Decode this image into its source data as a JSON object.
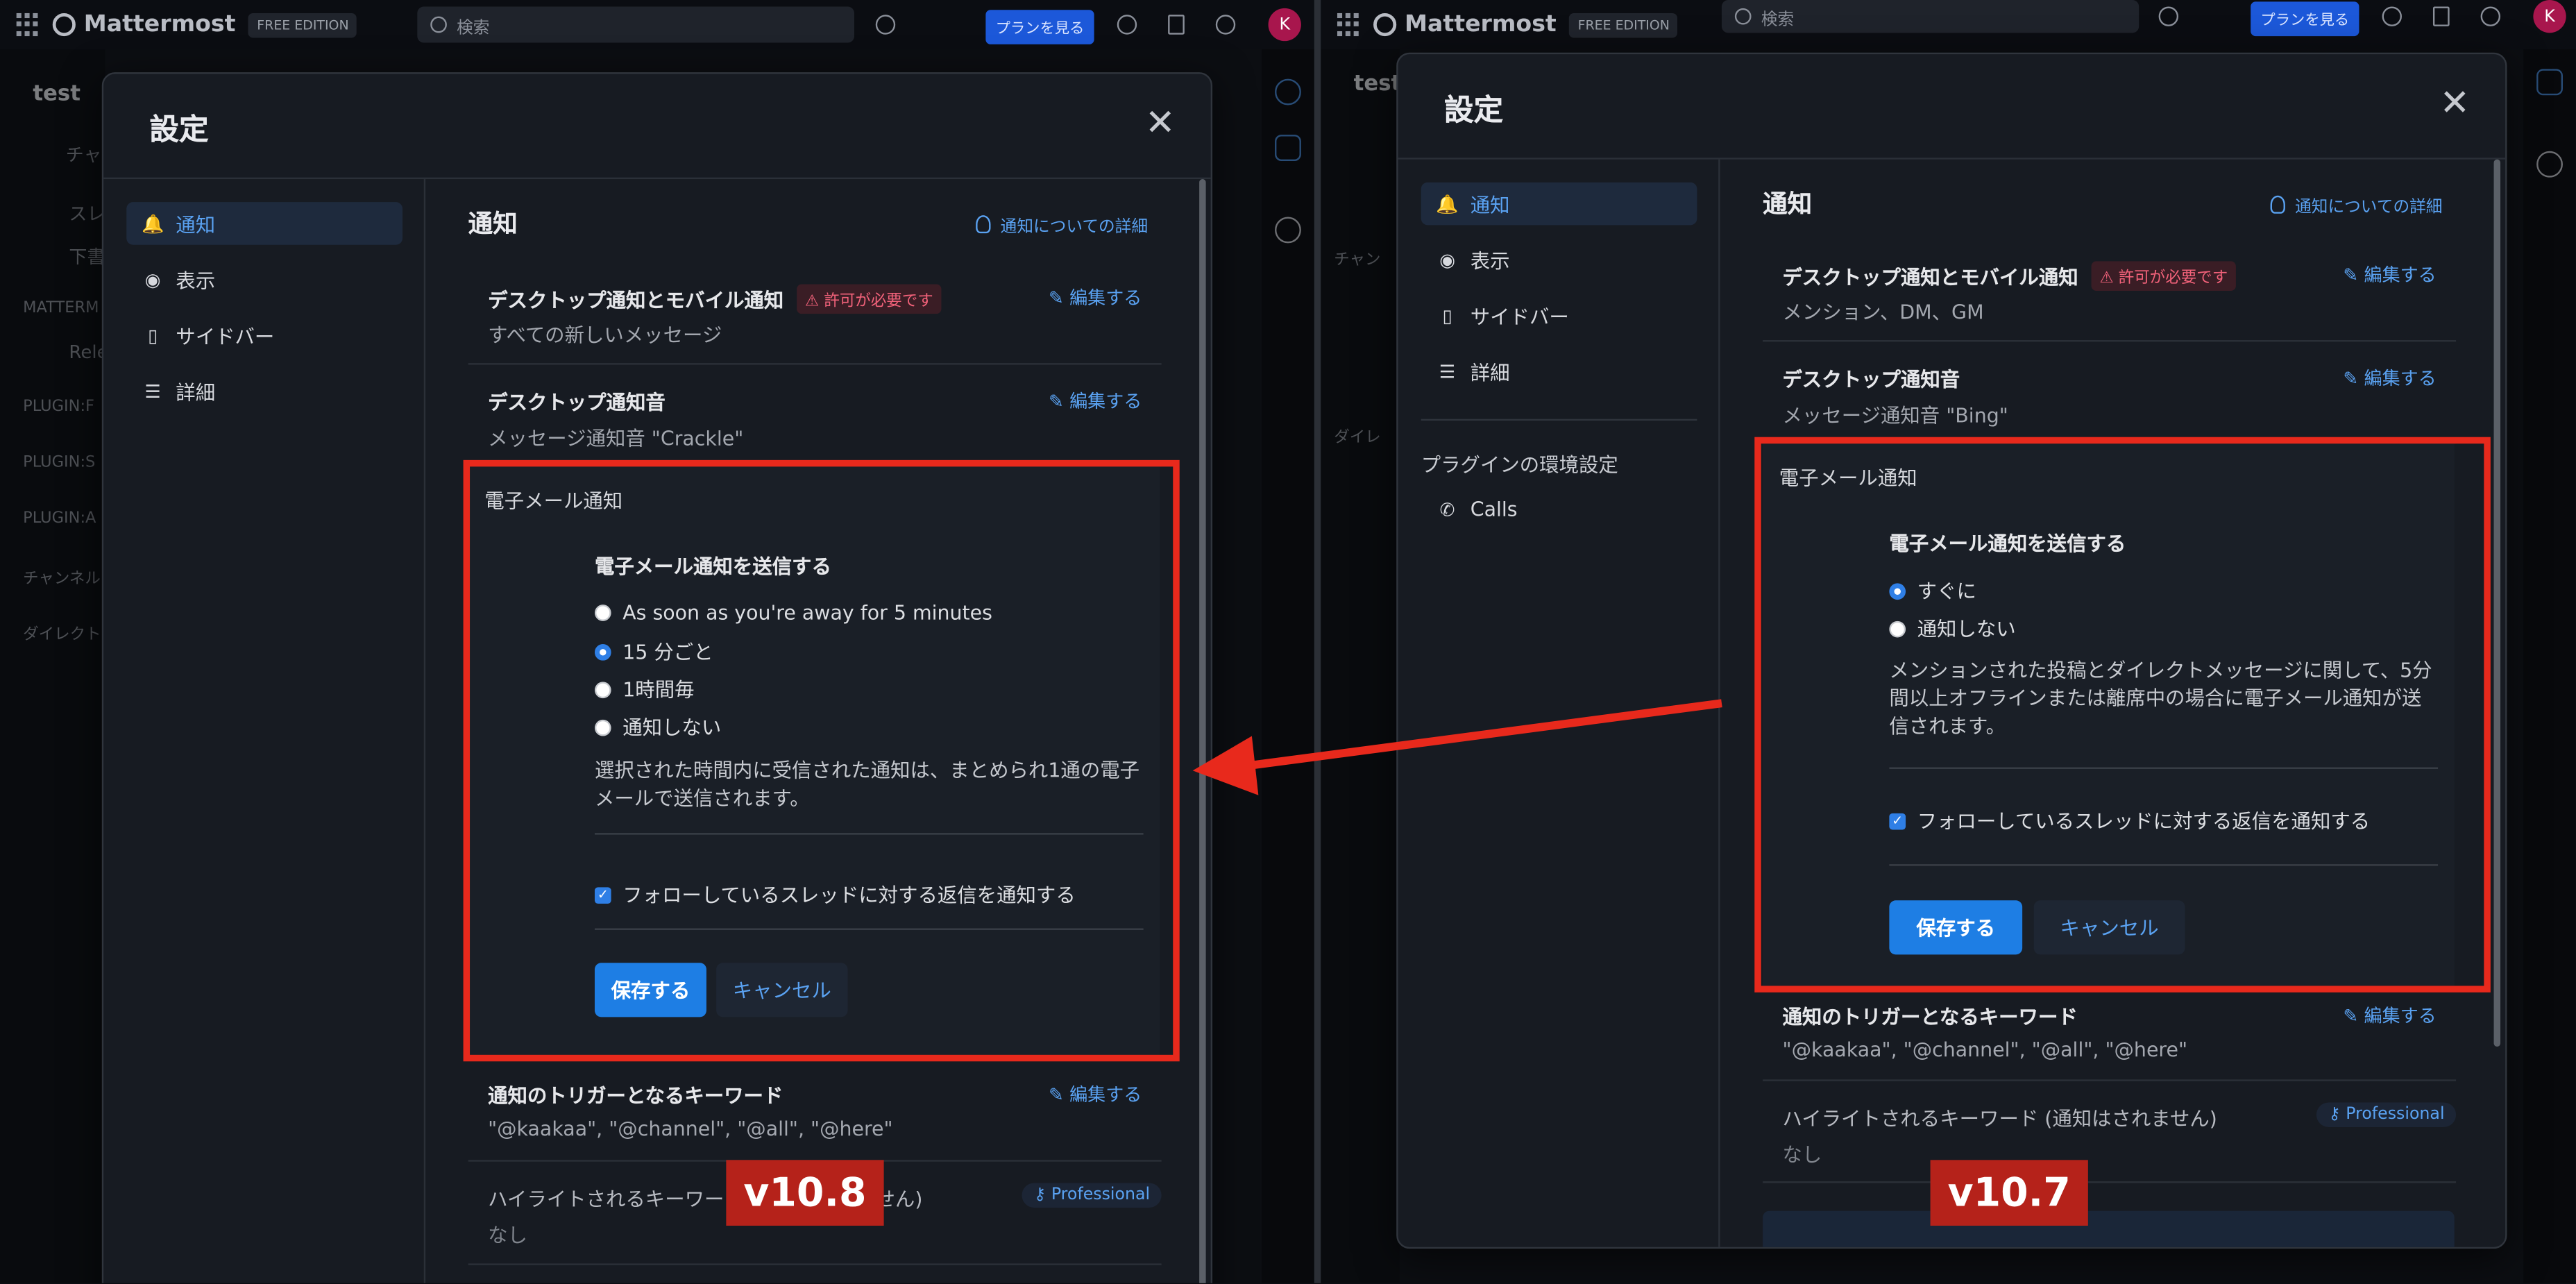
{
  "brand": {
    "name": "Mattermost",
    "edition": "FREE EDITION"
  },
  "topbar": {
    "search_placeholder": "検索",
    "plan_button": "プランを見る",
    "avatar_initial": "K"
  },
  "left_sidebar": {
    "team": "test",
    "search_partial": "チャ",
    "items": [
      "スレ",
      "下書",
      "MATTERM",
      "Rele",
      "PLUGIN:F",
      "PLUGIN:S",
      "PLUGIN:A",
      "チャンネル",
      "ダイレクト"
    ]
  },
  "right_sidebar": {
    "team": "test",
    "items": [
      "チャン",
      "ダイレ"
    ]
  },
  "modal": {
    "title": "設定",
    "close_glyph": "✕",
    "nav": [
      {
        "label": "通知",
        "icon": "bell-icon",
        "glyph": "🔔"
      },
      {
        "label": "表示",
        "icon": "eye-icon",
        "glyph": "◉"
      },
      {
        "label": "サイドバー",
        "icon": "sidebar-icon",
        "glyph": "▯"
      },
      {
        "label": "詳細",
        "icon": "sliders-icon",
        "glyph": "☰"
      }
    ],
    "plugin_heading": "プラグインの環境設定",
    "plugin_item": "Calls",
    "section_title": "通知",
    "learn_more": "通知についての詳細",
    "edit_label": "編集する",
    "permission_badge": "許可が必要です",
    "professional_badge": "Professional"
  },
  "v108": {
    "version_label": "v10.8",
    "desktop_title": "デスクトップ通知とモバイル通知",
    "desktop_value": "すべての新しいメッセージ",
    "sound_title": "デスクトップ通知音",
    "sound_value": "メッセージ通知音 \"Crackle\"",
    "email_label": "電子メール通知",
    "email_heading": "電子メール通知を送信する",
    "options": [
      "As soon as you're away for 5 minutes",
      "15 分ごと",
      "1時間毎",
      "通知しない"
    ],
    "selected_index": 1,
    "description": "選択された時間内に受信された通知は、まとめられ1通の電子メールで送信されます。",
    "thread_checkbox": "フォローしているスレッドに対する返信を通知する",
    "save": "保存する",
    "cancel": "キャンセル",
    "keywords_title": "通知のトリガーとなるキーワード",
    "keywords_value": "\"@kaakaa\", \"@channel\", \"@all\", \"@here\"",
    "highlight_title": "ハイライトされるキーワード (通知はされません)",
    "highlight_value": "なし"
  },
  "v107": {
    "version_label": "v10.7",
    "desktop_title": "デスクトップ通知とモバイル通知",
    "desktop_value": "メンション、DM、GM",
    "sound_title": "デスクトップ通知音",
    "sound_value": "メッセージ通知音 \"Bing\"",
    "email_label": "電子メール通知",
    "email_heading": "電子メール通知を送信する",
    "options": [
      "すぐに",
      "通知しない"
    ],
    "selected_index": 0,
    "description": "メンションされた投稿とダイレクトメッセージに関して、5分間以上オフラインまたは離席中の場合に電子メール通知が送信されます。",
    "thread_checkbox": "フォローしているスレッドに対する返信を通知する",
    "save": "保存する",
    "cancel": "キャンセル",
    "keywords_title": "通知のトリガーとなるキーワード",
    "keywords_value": "\"@kaakaa\", \"@channel\", \"@all\", \"@here\"",
    "highlight_title": "ハイライトされるキーワード (通知はされません)",
    "highlight_value": "なし"
  },
  "colors": {
    "accent": "#1e7ee4",
    "highlight_box": "#e8291c",
    "version_tag": "#b5221a"
  }
}
